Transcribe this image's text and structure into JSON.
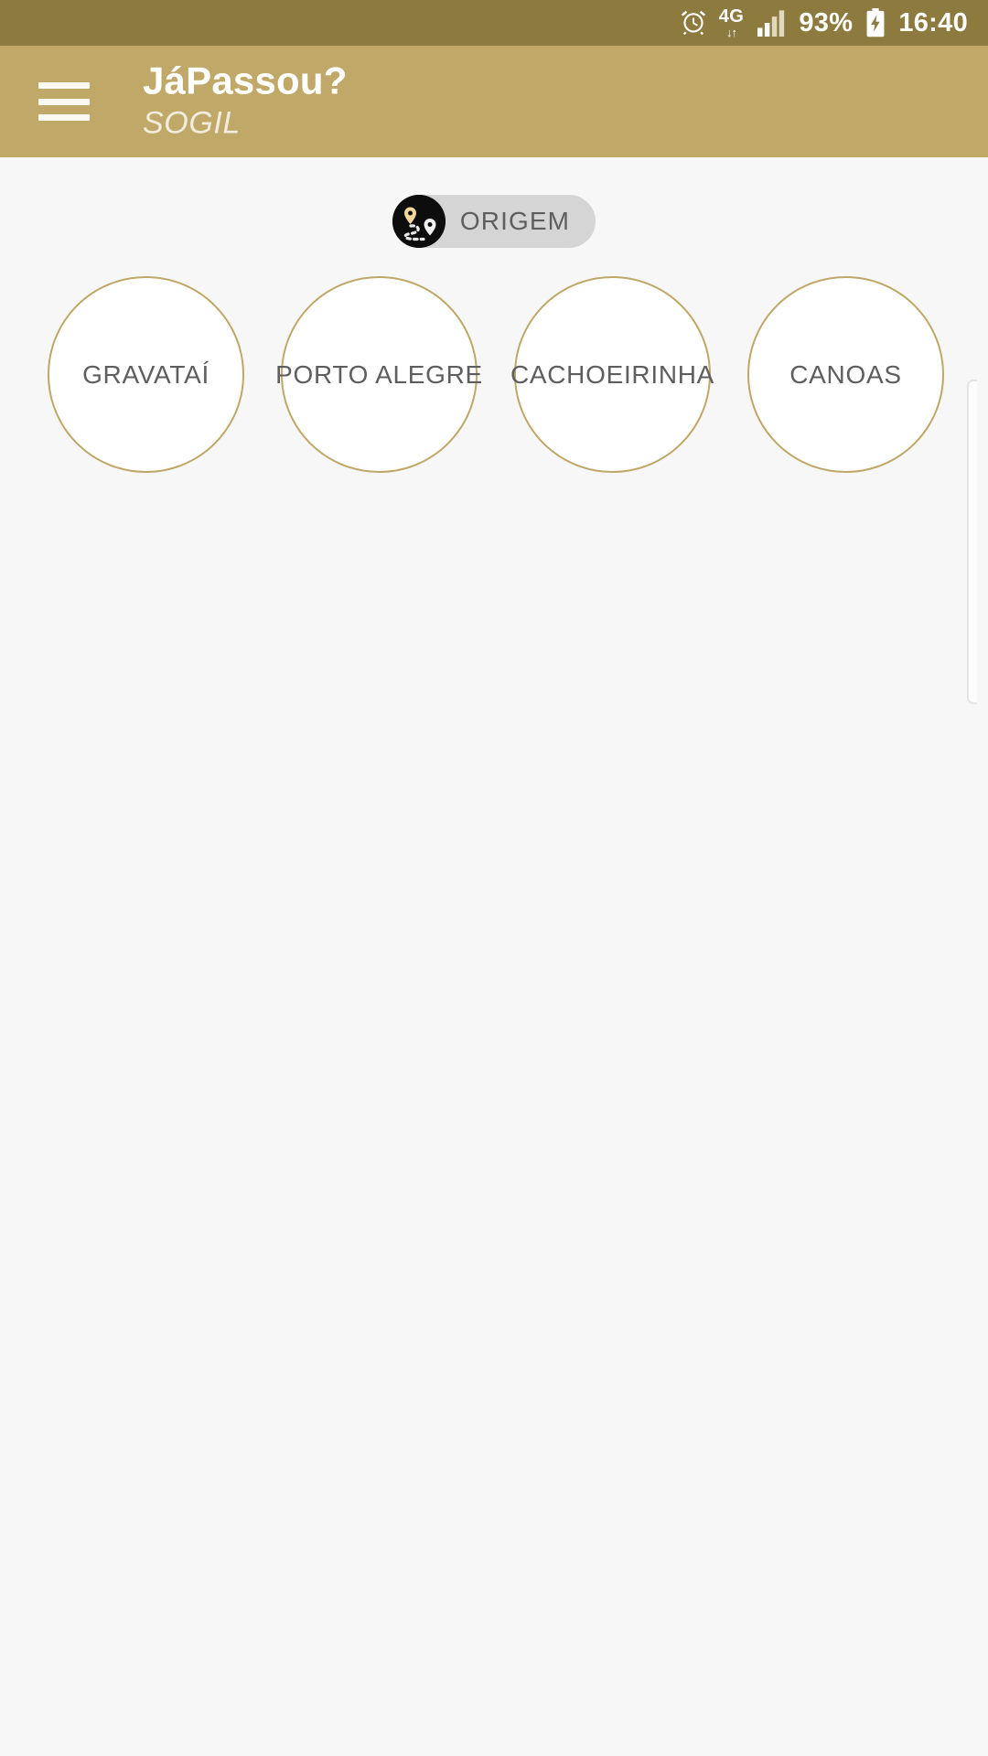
{
  "status_bar": {
    "alarm_icon": "alarm-clock-icon",
    "network_type": "4G",
    "network_arrows": "↓↑",
    "signal_icon": "signal-bars-icon",
    "battery_percent": "93%",
    "battery_icon": "battery-charging-icon",
    "time": "16:40",
    "background_color": "#8D7A3F"
  },
  "app_bar": {
    "menu_icon": "hamburger-menu-icon",
    "title": "JáPassou?",
    "subtitle": "SOGIL",
    "background_color": "#C0A968"
  },
  "filter_chip": {
    "icon": "route-pins-icon",
    "label": "ORIGEM",
    "background_color": "#D5D5D5",
    "text_color": "#5E5E5E"
  },
  "city_selector": {
    "border_color": "#BFA768",
    "text_color": "#5E5E5E",
    "cities": [
      {
        "label": "GRAVATAÍ"
      },
      {
        "label": "PORTO ALEGRE"
      },
      {
        "label": "CACHOEIRINHA"
      },
      {
        "label": "CANOAS"
      }
    ]
  },
  "page": {
    "background_color": "#F7F7F7"
  }
}
